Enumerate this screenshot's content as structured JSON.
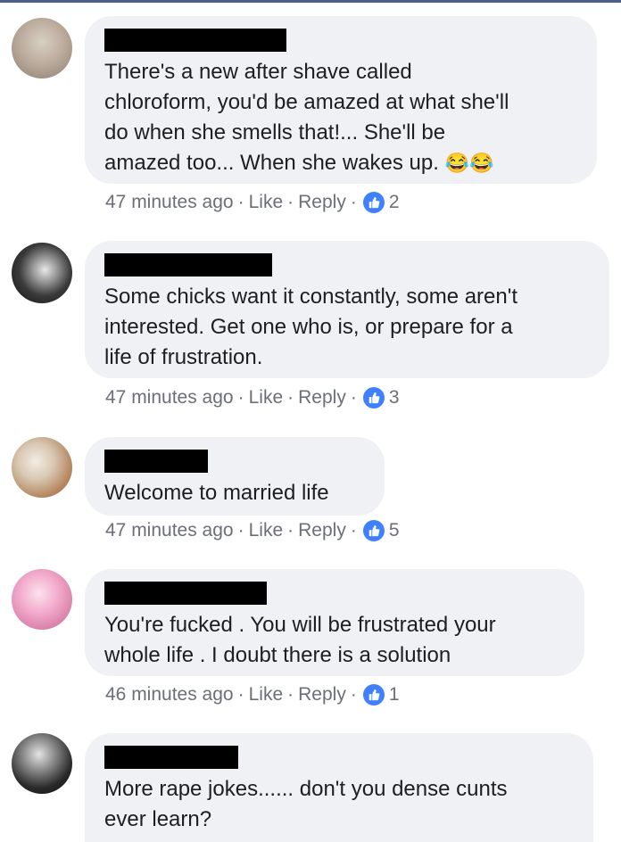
{
  "comments": [
    {
      "text": "There's a new after shave called\nchloroform, you'd be amazed at what she'll\ndo when she smells that!... She'll be\namazed too... When she wakes up.",
      "emoji": "😂😂",
      "time": "47 minutes ago",
      "like": "Like",
      "reply": "Reply",
      "reactions": "2"
    },
    {
      "text": "Some chicks want it constantly, some aren't\ninterested. Get one who is, or prepare for a\nlife of frustration.",
      "time": "47 minutes ago",
      "like": "Like",
      "reply": "Reply",
      "reactions": "3"
    },
    {
      "text": "Welcome to married life",
      "time": "47 minutes ago",
      "like": "Like",
      "reply": "Reply",
      "reactions": "5"
    },
    {
      "text": "You're fucked . You will be frustrated your\nwhole life . I doubt there is a solution",
      "time": "46 minutes ago",
      "like": "Like",
      "reply": "Reply",
      "reactions": "1"
    },
    {
      "text": "More rape jokes...... don't you dense cunts\never learn?"
    }
  ],
  "colors": {
    "bubble": "#f0f1f4",
    "like_badge": "#4080ff",
    "meta": "#6b6f76"
  },
  "icons": {
    "reaction": "thumbs-up-icon"
  }
}
